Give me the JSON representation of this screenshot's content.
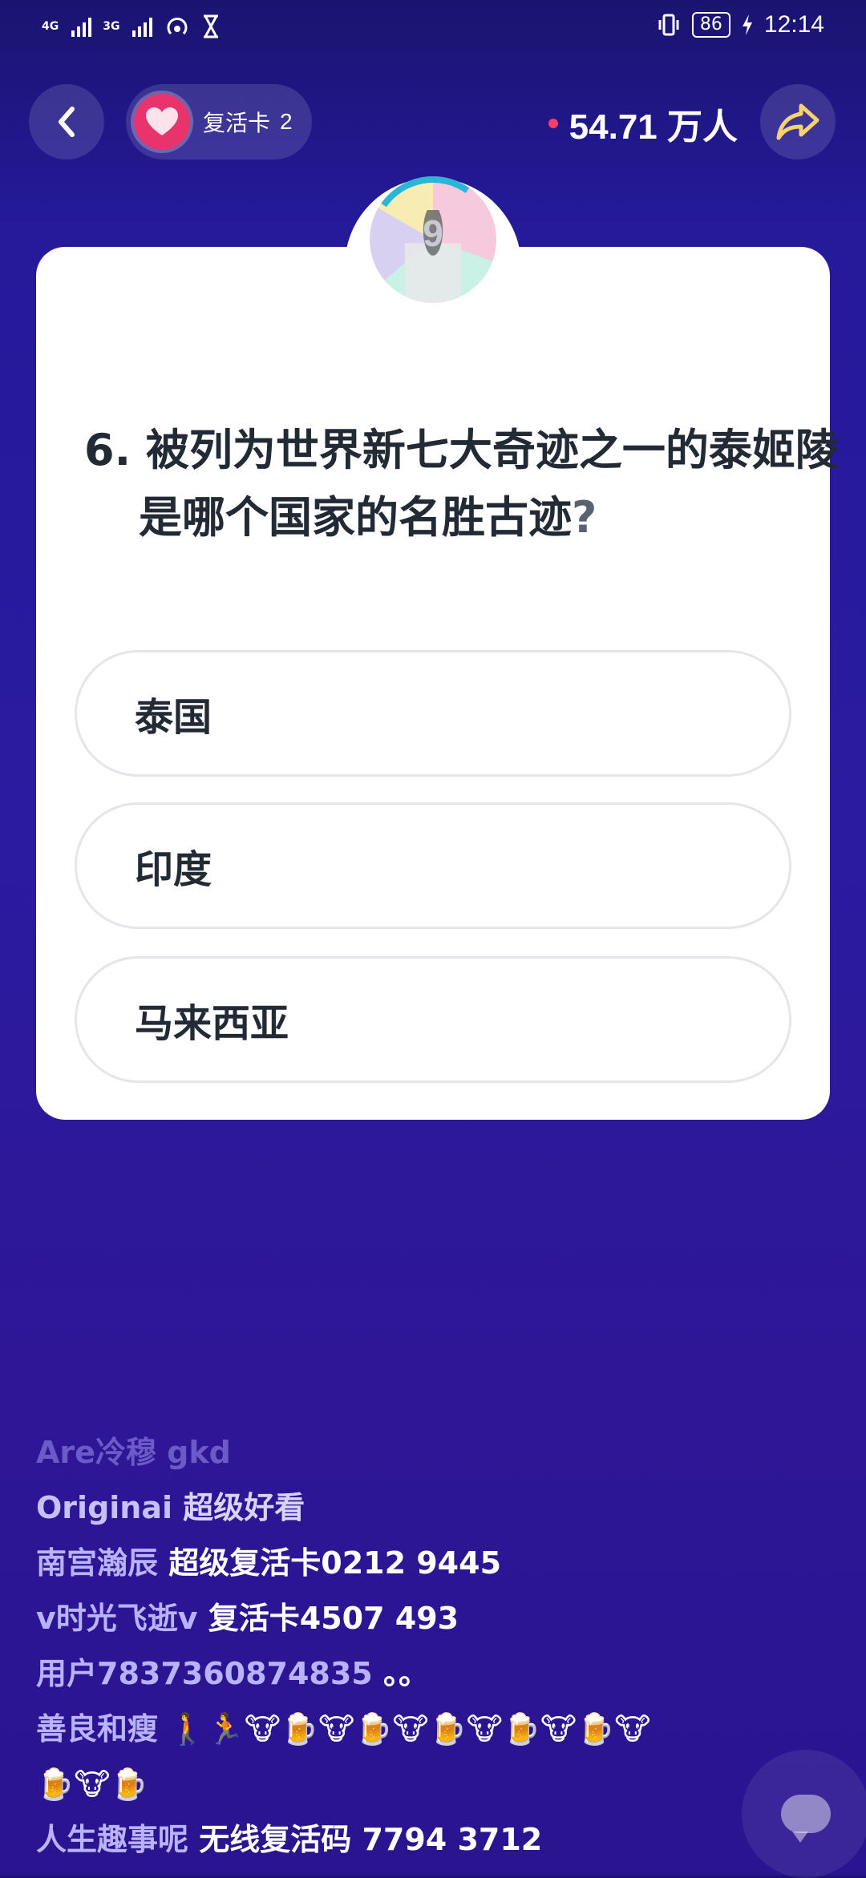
{
  "status_bar": {
    "network_1": "4G",
    "network_2": "3G",
    "battery": "86",
    "time": "12:14"
  },
  "header": {
    "revive_label": "复活卡",
    "revive_count": "2",
    "viewer_count": "54.71 万人"
  },
  "timer": {
    "seconds": "9"
  },
  "question": {
    "number": "6.",
    "text": "被列为世界新七大奇迹之一的泰姬陵是哪个国家的名胜古迹",
    "mark": "?"
  },
  "options": [
    {
      "label": "泰国"
    },
    {
      "label": "印度"
    },
    {
      "label": "马来西亚"
    }
  ],
  "comments": [
    {
      "user": "Are冷穆",
      "message": "gkd"
    },
    {
      "user": "Originai",
      "message": "超级好看"
    },
    {
      "user": "南宫瀚辰",
      "message": "超级复活卡0212 9445"
    },
    {
      "user": "v时光飞逝v",
      "message": "复活卡4507 493"
    },
    {
      "user": "用户7837360874835",
      "message": "。。"
    },
    {
      "user": "善良和瘦",
      "message": "🚶🏃🐮🍺🐮🍺🐮🍺🐮🍺🐮🍺🐮"
    },
    {
      "user": "",
      "message": "🍺🐮🍺"
    },
    {
      "user": "人生趣事呢",
      "message": "无线复活码 7794 3712"
    }
  ],
  "colors": {
    "background": "#2b1ba0",
    "accent_live": "#ff3b6b",
    "heart": "#e9336c",
    "question_text": "#222a35"
  },
  "icons": [
    "back-arrow-icon",
    "heart-icon",
    "share-icon",
    "chat-icon",
    "vibrate-icon",
    "charging-icon",
    "hotspot-icon",
    "hourglass-icon"
  ]
}
